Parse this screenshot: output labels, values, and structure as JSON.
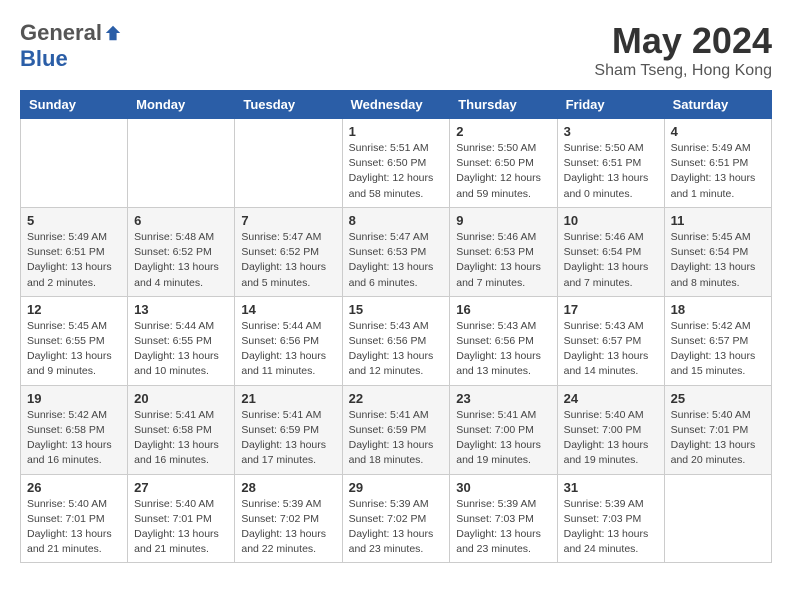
{
  "logo": {
    "general": "General",
    "blue": "Blue"
  },
  "title": "May 2024",
  "location": "Sham Tseng, Hong Kong",
  "days_of_week": [
    "Sunday",
    "Monday",
    "Tuesday",
    "Wednesday",
    "Thursday",
    "Friday",
    "Saturday"
  ],
  "weeks": [
    [
      {
        "day": "",
        "info": ""
      },
      {
        "day": "",
        "info": ""
      },
      {
        "day": "",
        "info": ""
      },
      {
        "day": "1",
        "info": "Sunrise: 5:51 AM\nSunset: 6:50 PM\nDaylight: 12 hours and 58 minutes."
      },
      {
        "day": "2",
        "info": "Sunrise: 5:50 AM\nSunset: 6:50 PM\nDaylight: 12 hours and 59 minutes."
      },
      {
        "day": "3",
        "info": "Sunrise: 5:50 AM\nSunset: 6:51 PM\nDaylight: 13 hours and 0 minutes."
      },
      {
        "day": "4",
        "info": "Sunrise: 5:49 AM\nSunset: 6:51 PM\nDaylight: 13 hours and 1 minute."
      }
    ],
    [
      {
        "day": "5",
        "info": "Sunrise: 5:49 AM\nSunset: 6:51 PM\nDaylight: 13 hours and 2 minutes."
      },
      {
        "day": "6",
        "info": "Sunrise: 5:48 AM\nSunset: 6:52 PM\nDaylight: 13 hours and 4 minutes."
      },
      {
        "day": "7",
        "info": "Sunrise: 5:47 AM\nSunset: 6:52 PM\nDaylight: 13 hours and 5 minutes."
      },
      {
        "day": "8",
        "info": "Sunrise: 5:47 AM\nSunset: 6:53 PM\nDaylight: 13 hours and 6 minutes."
      },
      {
        "day": "9",
        "info": "Sunrise: 5:46 AM\nSunset: 6:53 PM\nDaylight: 13 hours and 7 minutes."
      },
      {
        "day": "10",
        "info": "Sunrise: 5:46 AM\nSunset: 6:54 PM\nDaylight: 13 hours and 7 minutes."
      },
      {
        "day": "11",
        "info": "Sunrise: 5:45 AM\nSunset: 6:54 PM\nDaylight: 13 hours and 8 minutes."
      }
    ],
    [
      {
        "day": "12",
        "info": "Sunrise: 5:45 AM\nSunset: 6:55 PM\nDaylight: 13 hours and 9 minutes."
      },
      {
        "day": "13",
        "info": "Sunrise: 5:44 AM\nSunset: 6:55 PM\nDaylight: 13 hours and 10 minutes."
      },
      {
        "day": "14",
        "info": "Sunrise: 5:44 AM\nSunset: 6:56 PM\nDaylight: 13 hours and 11 minutes."
      },
      {
        "day": "15",
        "info": "Sunrise: 5:43 AM\nSunset: 6:56 PM\nDaylight: 13 hours and 12 minutes."
      },
      {
        "day": "16",
        "info": "Sunrise: 5:43 AM\nSunset: 6:56 PM\nDaylight: 13 hours and 13 minutes."
      },
      {
        "day": "17",
        "info": "Sunrise: 5:43 AM\nSunset: 6:57 PM\nDaylight: 13 hours and 14 minutes."
      },
      {
        "day": "18",
        "info": "Sunrise: 5:42 AM\nSunset: 6:57 PM\nDaylight: 13 hours and 15 minutes."
      }
    ],
    [
      {
        "day": "19",
        "info": "Sunrise: 5:42 AM\nSunset: 6:58 PM\nDaylight: 13 hours and 16 minutes."
      },
      {
        "day": "20",
        "info": "Sunrise: 5:41 AM\nSunset: 6:58 PM\nDaylight: 13 hours and 16 minutes."
      },
      {
        "day": "21",
        "info": "Sunrise: 5:41 AM\nSunset: 6:59 PM\nDaylight: 13 hours and 17 minutes."
      },
      {
        "day": "22",
        "info": "Sunrise: 5:41 AM\nSunset: 6:59 PM\nDaylight: 13 hours and 18 minutes."
      },
      {
        "day": "23",
        "info": "Sunrise: 5:41 AM\nSunset: 7:00 PM\nDaylight: 13 hours and 19 minutes."
      },
      {
        "day": "24",
        "info": "Sunrise: 5:40 AM\nSunset: 7:00 PM\nDaylight: 13 hours and 19 minutes."
      },
      {
        "day": "25",
        "info": "Sunrise: 5:40 AM\nSunset: 7:01 PM\nDaylight: 13 hours and 20 minutes."
      }
    ],
    [
      {
        "day": "26",
        "info": "Sunrise: 5:40 AM\nSunset: 7:01 PM\nDaylight: 13 hours and 21 minutes."
      },
      {
        "day": "27",
        "info": "Sunrise: 5:40 AM\nSunset: 7:01 PM\nDaylight: 13 hours and 21 minutes."
      },
      {
        "day": "28",
        "info": "Sunrise: 5:39 AM\nSunset: 7:02 PM\nDaylight: 13 hours and 22 minutes."
      },
      {
        "day": "29",
        "info": "Sunrise: 5:39 AM\nSunset: 7:02 PM\nDaylight: 13 hours and 23 minutes."
      },
      {
        "day": "30",
        "info": "Sunrise: 5:39 AM\nSunset: 7:03 PM\nDaylight: 13 hours and 23 minutes."
      },
      {
        "day": "31",
        "info": "Sunrise: 5:39 AM\nSunset: 7:03 PM\nDaylight: 13 hours and 24 minutes."
      },
      {
        "day": "",
        "info": ""
      }
    ]
  ]
}
